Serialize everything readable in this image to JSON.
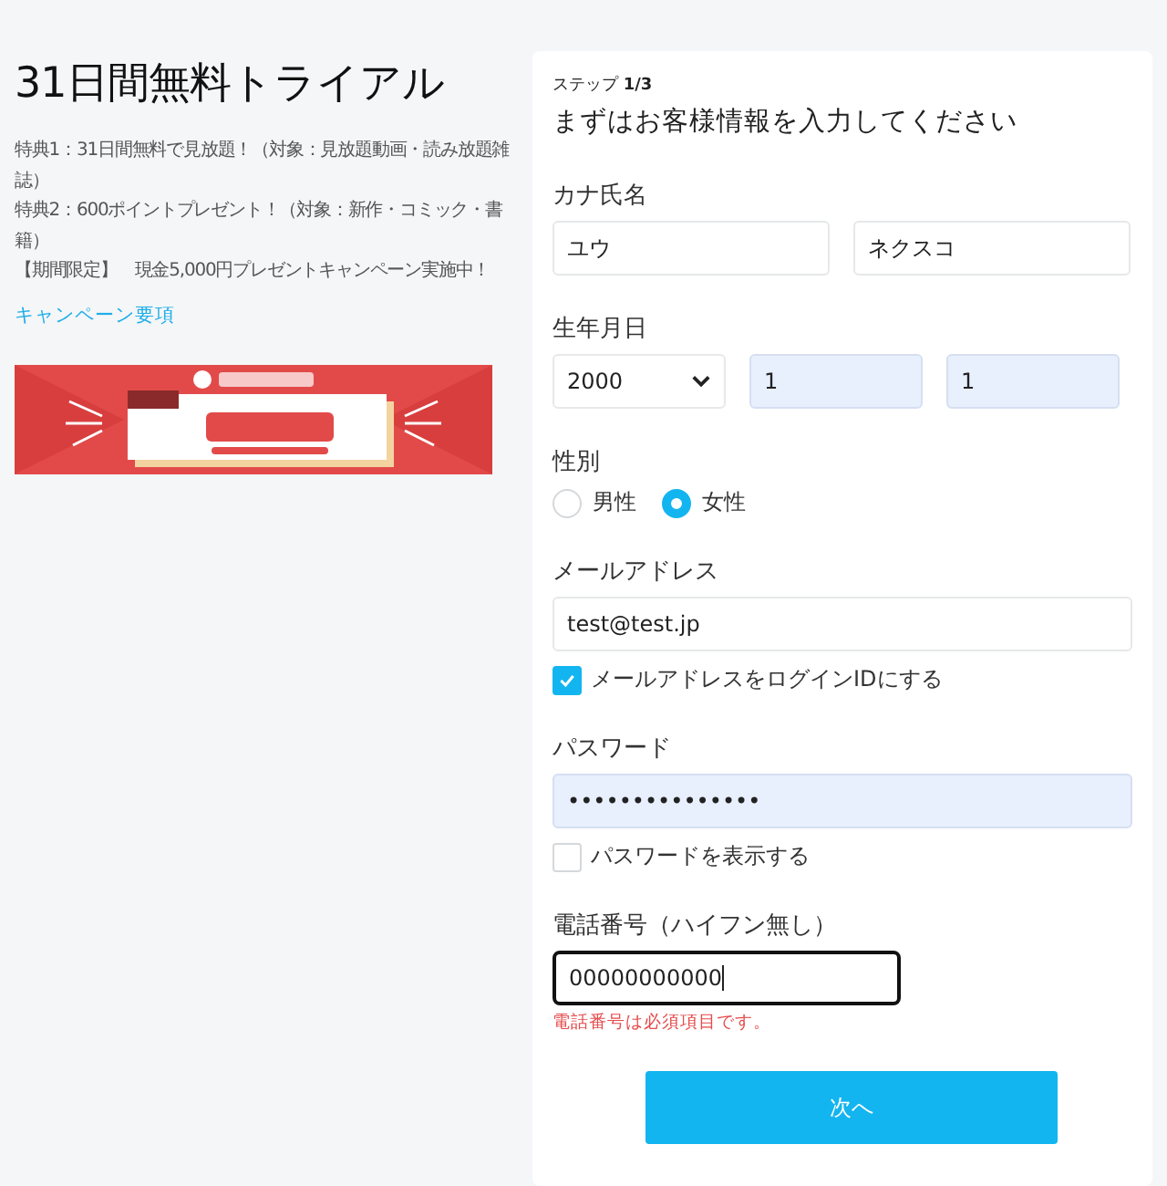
{
  "promo": {
    "title": "31日間無料トライアル",
    "lines": [
      "特典1：31日間無料で見放題！（対象：見放題動画・読み放題雑誌）",
      "特典2：600ポイントプレゼント！（対象：新作・コミック・書籍）",
      "【期間限定】　現金5,000円プレゼントキャンペーン実施中！"
    ],
    "link": "キャンペーン要項"
  },
  "form": {
    "step": "ステップ **1/3**",
    "heading": "まずはお客様情報を入力してください",
    "name": {
      "label": "カナ氏名",
      "values": [
        {
          "value": "ユウ",
          "autofilled": false
        },
        {
          "value": "ネクスコ",
          "autofilled": false
        }
      ]
    },
    "birth": {
      "label": "生年月日",
      "year": "2000",
      "month": {
        "value": "1",
        "autofilled": true
      },
      "day": {
        "value": "1",
        "autofilled": true
      }
    },
    "gender": {
      "label": "性別",
      "options": [
        {
          "label": "男性",
          "selected": false
        },
        {
          "label": "女性",
          "selected": true
        }
      ]
    },
    "email": {
      "label": "メールアドレス",
      "value": "test@test.jp",
      "checkbox": {
        "label": "メールアドレスをログインIDにする",
        "checked": true
      }
    },
    "password": {
      "label": "パスワード",
      "value": "•••••••••••••••",
      "autofilled": true,
      "checkbox": {
        "label": "パスワードを表示する",
        "checked": false
      }
    },
    "phone": {
      "label": "電話番号（ハイフン無し）",
      "value": "00000000000",
      "focused": true,
      "error": "電話番号は必須項目です。"
    },
    "submit": "次へ"
  }
}
